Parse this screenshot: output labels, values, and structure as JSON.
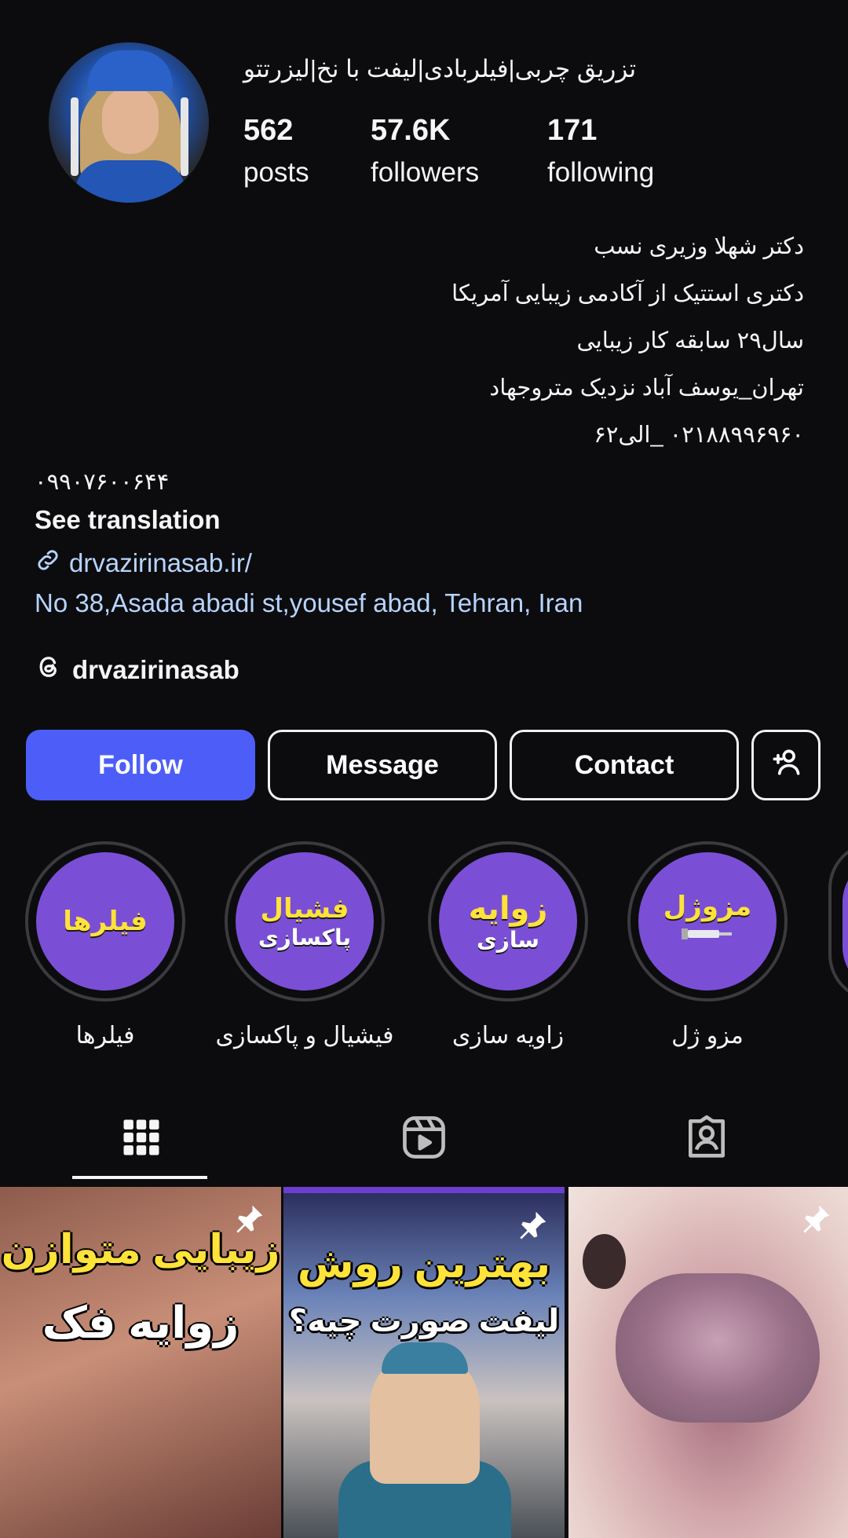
{
  "profile": {
    "name_header": "تزریق چربی|فیلربادی|لیفت با نخ|لیزرتتو",
    "stats": {
      "posts": {
        "value": "562",
        "label": "posts"
      },
      "followers": {
        "value": "57.6K",
        "label": "followers"
      },
      "following": {
        "value": "171",
        "label": "following"
      }
    },
    "bio_lines": [
      "دکتر شهلا وزیری نسب",
      "دکتری استتیک از آکادمی زیبایی آمریکا",
      "سال۲۹ سابقه کار زیبایی",
      "تهران_یوسف آباد نزدیک متروجهاد",
      "۰۲۱۸۸۹۹۶۹۶۰ _الی۶۲",
      "۰۹۹۰۷۶۰۰۶۴۴"
    ],
    "see_translation": "See translation",
    "link": "drvazirinasab.ir/",
    "address": "No 38,Asada abadi st,yousef abad, Tehran, Iran",
    "threads_handle": "drvazirinasab"
  },
  "buttons": {
    "follow": "Follow",
    "message": "Message",
    "contact": "Contact"
  },
  "highlights": [
    {
      "cover": "فیلرها",
      "cover_sub": "",
      "label": "فیلرها"
    },
    {
      "cover": "فشیال",
      "cover_sub": "پاکسازی",
      "label": "فیشیال و پاکسازی"
    },
    {
      "cover": "زوایه",
      "cover_sub": "سازی",
      "label": "زاویه سازی"
    },
    {
      "cover": "مزوژل",
      "cover_sub": "",
      "label": "مزو ژل"
    }
  ],
  "tabs": [
    "grid-icon",
    "reels-icon",
    "tagged-icon"
  ],
  "posts": [
    {
      "line1": "زیبایی متوازن",
      "line2": "زوایه فک"
    },
    {
      "line1": "بهترین روش",
      "line2": "لیفت صورت چیه؟"
    },
    {
      "line1": "",
      "line2": ""
    }
  ],
  "colors": {
    "accent": "#4d5ef8",
    "link": "#b7d4ff",
    "highlight": "#7a4fd6",
    "background": "#0c0c0e"
  }
}
